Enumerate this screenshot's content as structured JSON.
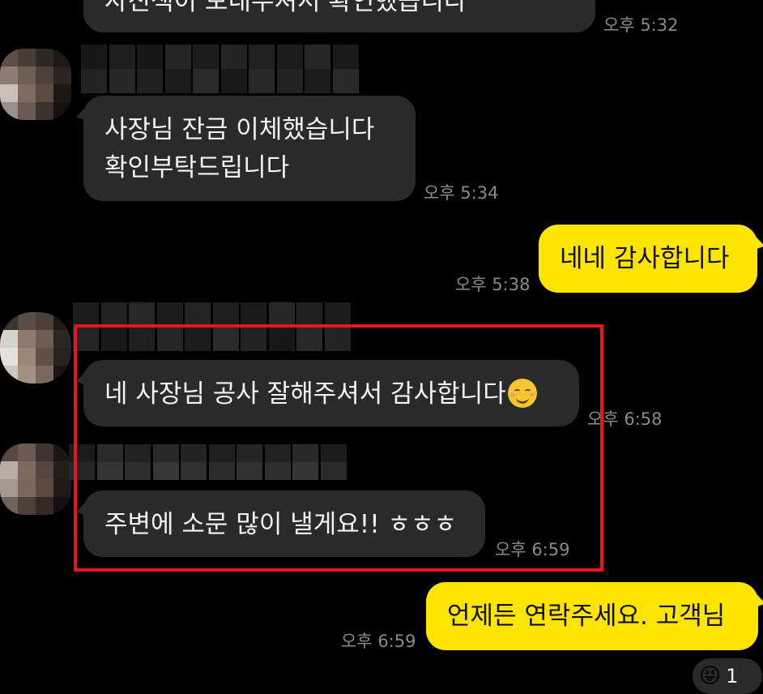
{
  "messages": [
    {
      "side": "in",
      "text": "사진색이 보내주셔서 확인했습니다",
      "time": "오후 5:32"
    },
    {
      "side": "in",
      "lines": [
        "사장님 잔금 이체했습니다",
        "확인부탁드립니다"
      ],
      "time": "오후 5:34"
    },
    {
      "side": "out",
      "text": "네네 감사합니다",
      "time": "오후 5:38"
    },
    {
      "side": "in",
      "text": "네 사장님 공사 잘해주셔서 감사합니다",
      "emoji": "smiling-face-icon",
      "time": "오후 6:58"
    },
    {
      "side": "in",
      "text": "주변에 소문 많이 낼게요!! ㅎㅎㅎ",
      "time": "오후 6:59"
    },
    {
      "side": "out",
      "text": "언제든 연락주세요. 고객님",
      "time": "오후 6:59"
    }
  ],
  "reaction": {
    "icon": "laughing-face-icon",
    "count": "1"
  },
  "colors": {
    "background": "#000000",
    "incoming_bubble": "#2a2a2a",
    "outgoing_bubble": "#fee500",
    "timestamp": "#8a8a8a",
    "highlight": "#e8151b"
  }
}
